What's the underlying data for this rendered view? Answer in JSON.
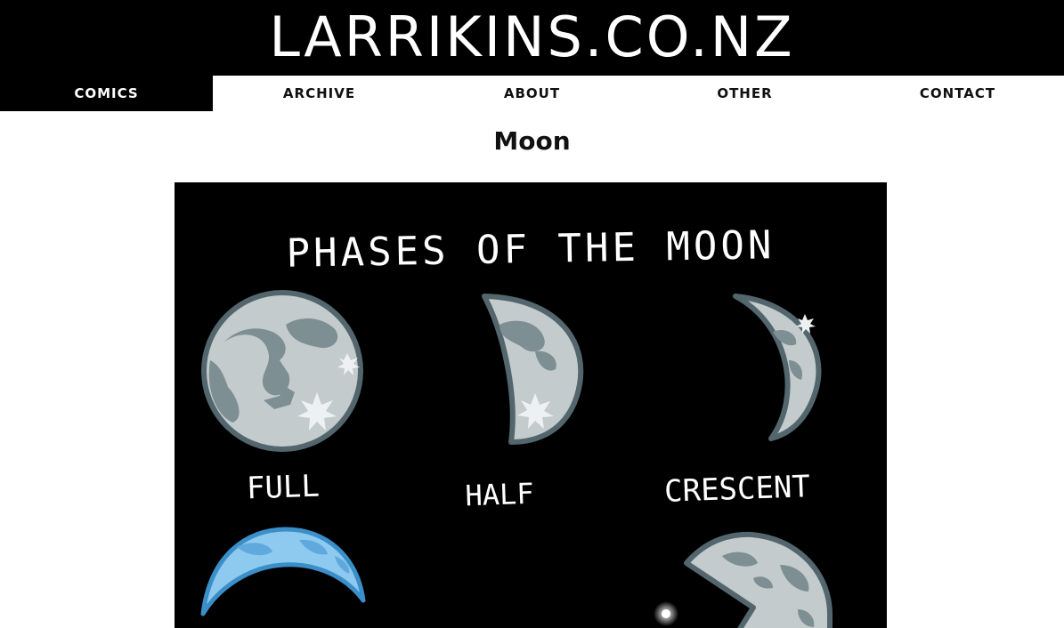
{
  "site": {
    "logo": "LARRIKINS.CO.NZ"
  },
  "nav": {
    "items": [
      {
        "label": "COMICS",
        "active": true
      },
      {
        "label": "ARCHIVE",
        "active": false
      },
      {
        "label": "ABOUT",
        "active": false
      },
      {
        "label": "OTHER",
        "active": false
      },
      {
        "label": "CONTACT",
        "active": false
      }
    ]
  },
  "page": {
    "title": "Moon"
  },
  "comic": {
    "heading": "PHASES OF THE MOON",
    "labels": {
      "full": "FULL",
      "half": "HALF",
      "crescent": "CRESCENT"
    },
    "colors": {
      "background": "#000000",
      "moon": "#c4cbcc",
      "crater": "#7e8f94",
      "rim": "#53666d",
      "blue_moon": "#8ec9ef",
      "blue_rim": "#3a8fc9"
    }
  }
}
